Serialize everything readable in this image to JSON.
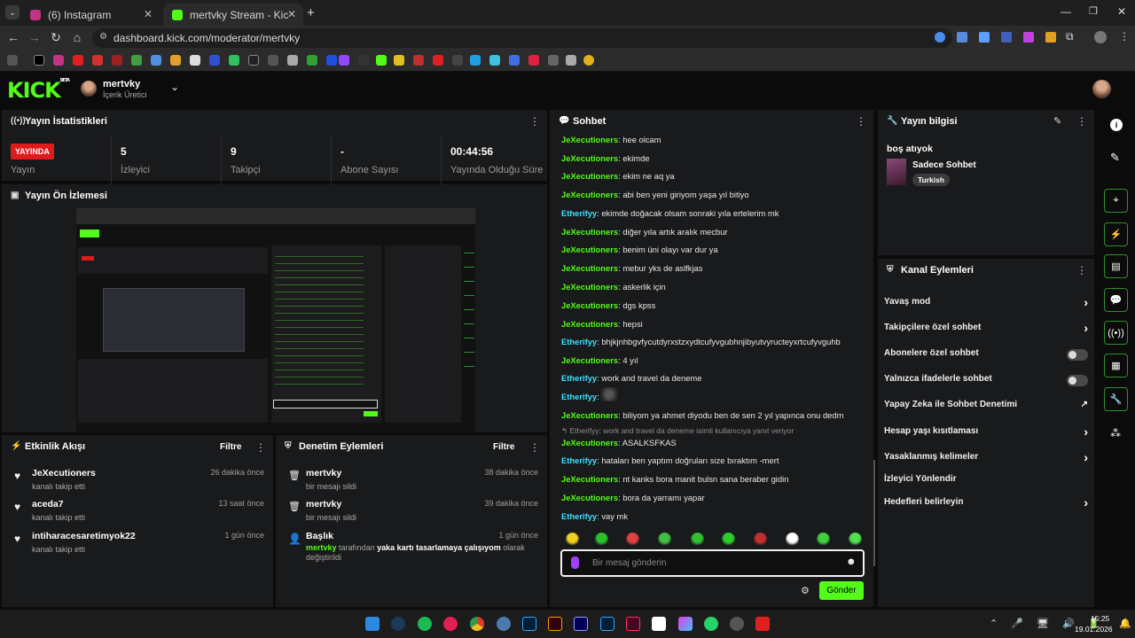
{
  "browser": {
    "tabs": [
      {
        "title": "(6) Instagram",
        "color": "#c13584"
      },
      {
        "title": "mertvky Stream - Kick Dashboa",
        "color": "#53fc18"
      }
    ],
    "url": "dashboard.kick.com/moderator/mertvky"
  },
  "header": {
    "logo": "KICK",
    "logo_sup": "BETA",
    "channel_name": "mertvky",
    "channel_role": "İçerik Üretici"
  },
  "stats": {
    "title": "Yayın İstatistikleri",
    "live_badge": "YAYINDA",
    "items": [
      {
        "value": "",
        "label": "Yayın"
      },
      {
        "value": "5",
        "label": "İzleyici"
      },
      {
        "value": "9",
        "label": "Takipçi"
      },
      {
        "value": "-",
        "label": "Abone Sayısı"
      },
      {
        "value": "00:44:56",
        "label": "Yayında Olduğu Süre"
      }
    ]
  },
  "preview": {
    "title": "Yayın Ön İzlemesi"
  },
  "activity": {
    "title": "Etkinlik Akışı",
    "filter": "Filtre",
    "items": [
      {
        "user": "JeXecutioners",
        "text": "kanalı takip etti",
        "time": "26 dakika önce"
      },
      {
        "user": "aceda7",
        "text": "kanalı takip etti",
        "time": "13 saat önce"
      },
      {
        "user": "intiharacesaretimyok22",
        "text": "kanalı takip etti",
        "time": "1 gün önce"
      }
    ]
  },
  "moderation": {
    "title": "Denetim Eylemleri",
    "filter": "Filtre",
    "items": [
      {
        "user": "mertvky",
        "text": "bir mesajı sildi",
        "time": "38 dakika önce"
      },
      {
        "user": "mertvky",
        "text": "bir mesajı sildi",
        "time": "39 dakika önce"
      }
    ],
    "title_change": {
      "label": "Başlık",
      "time": "1 gün önce",
      "by": "mertvky",
      "by_suffix": "tarafından",
      "new_title": "yaka kartı tasarlamaya çalışıyom",
      "tail": "olarak",
      "tail2": "değiştirildi"
    }
  },
  "chat": {
    "title": "Sohbet",
    "reply_note": "Etherifyy: work and travel da deneme isimli kullanıcıya yanıt veriyor",
    "messages": [
      {
        "user": "JeXecutioners",
        "text": "hee olcam",
        "color": "#53fc18"
      },
      {
        "user": "JeXecutioners",
        "text": "ekimde",
        "color": "#53fc18"
      },
      {
        "user": "JeXecutioners",
        "text": "ekim ne aq ya",
        "color": "#53fc18"
      },
      {
        "user": "JeXecutioners",
        "text": "abi ben yeni giriyom yaşa yıl bitiyo",
        "color": "#53fc18"
      },
      {
        "user": "Etherifyy",
        "text": "ekimde doğacak olsam sonraki yıla ertelerim mk",
        "color": "#3de0ff"
      },
      {
        "user": "JeXecutioners",
        "text": "diğer yıla artık aralık mecbur",
        "color": "#53fc18"
      },
      {
        "user": "JeXecutioners",
        "text": "benim üni olayı var dur ya",
        "color": "#53fc18"
      },
      {
        "user": "JeXecutioners",
        "text": "mebur yks de aslfkjas",
        "color": "#53fc18"
      },
      {
        "user": "JeXecutioners",
        "text": "askerlik için",
        "color": "#53fc18"
      },
      {
        "user": "JeXecutioners",
        "text": "dgs kpss",
        "color": "#53fc18"
      },
      {
        "user": "JeXecutioners",
        "text": "hepsi",
        "color": "#53fc18"
      },
      {
        "user": "Etherifyy",
        "text": "bhjkjnhbgvfycutdyrxstzxydtcufyvgubhnjibyutvyructeyxrtcufyvguhb",
        "color": "#3de0ff"
      },
      {
        "user": "JeXecutioners",
        "text": "4 yıl",
        "color": "#53fc18"
      },
      {
        "user": "Etherifyy",
        "text": "work and travel da deneme",
        "color": "#3de0ff"
      },
      {
        "user": "Etherifyy",
        "text": "",
        "color": "#3de0ff"
      },
      {
        "user": "JeXecutioners",
        "text": "biliyom ya ahmet diyodu ben de sen 2 yıl yapınca onu dedm",
        "color": "#53fc18"
      },
      {
        "user": "JeXecutioners",
        "text": "ASALKSFKAS",
        "color": "#53fc18"
      },
      {
        "user": "Etherifyy",
        "text": "hataları ben yaptım doğruları size bıraktım -mert",
        "color": "#3de0ff"
      },
      {
        "user": "JeXecutioners",
        "text": "nt kanks bora manit bulsn sana beraber gidin",
        "color": "#53fc18"
      },
      {
        "user": "JeXecutioners",
        "text": "bora da yarramı yapar",
        "color": "#53fc18"
      },
      {
        "user": "Etherifyy",
        "text": "vay mk",
        "color": "#3de0ff"
      }
    ],
    "input_placeholder": "Bir mesaj gönderin",
    "send_label": "Gönder"
  },
  "stream_info": {
    "title": "Yayın bilgisi",
    "stream_title": "boş atıyok",
    "category": "Sadece Sohbet",
    "tag": "Turkish"
  },
  "channel_actions": {
    "title": "Kanal Eylemleri",
    "items": [
      {
        "label": "Yavaş mod",
        "control": "chevron"
      },
      {
        "label": "Takipçilere özel sohbet",
        "control": "chevron"
      },
      {
        "label": "Abonelere özel sohbet",
        "control": "toggle"
      },
      {
        "label": "Yalnızca ifadelerle sohbet",
        "control": "toggle"
      },
      {
        "label": "Yapay Zeka ile Sohbet Denetimi",
        "control": "external"
      },
      {
        "label": "Hesap yaşı kısıtlaması",
        "control": "chevron"
      },
      {
        "label": "Yasaklanmış kelimeler",
        "control": "chevron"
      },
      {
        "label": "İzleyici Yönlendir",
        "control": "none"
      },
      {
        "label": "Hedefleri belirleyin",
        "control": "chevron"
      }
    ]
  },
  "taskbar": {
    "time": "15:25",
    "date": "19.01.2026"
  },
  "colors": {
    "accent": "#53fc18",
    "live": "#e01b1b",
    "panel": "#191a1c"
  }
}
